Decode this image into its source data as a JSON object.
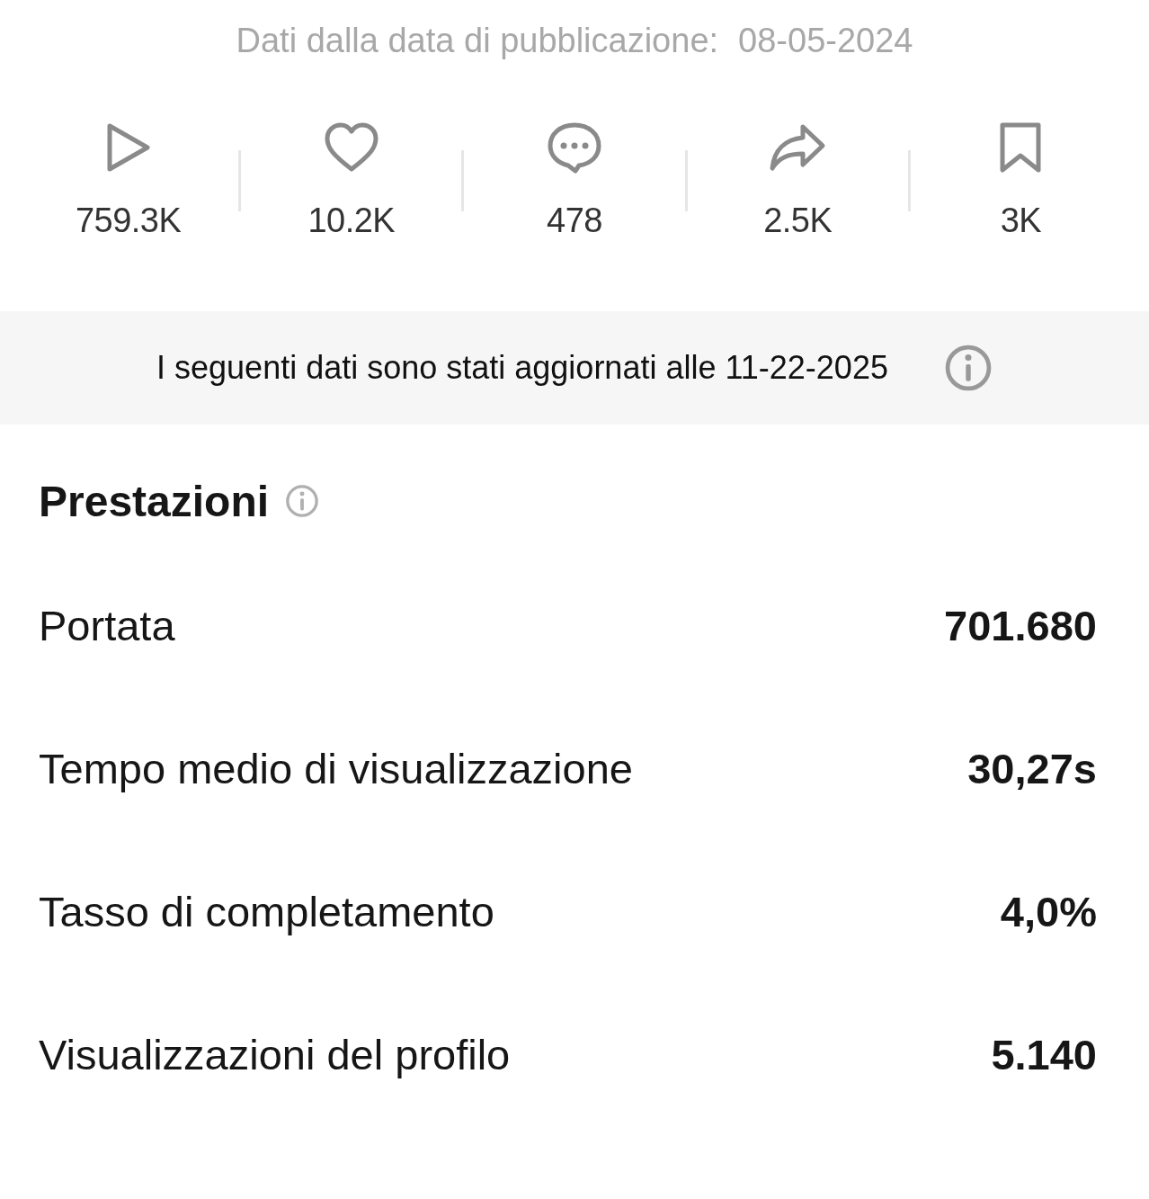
{
  "header": {
    "label": "Dati dalla data di pubblicazione:",
    "date": "08-05-2024"
  },
  "stats": [
    {
      "kind": "play",
      "value": "759.3K"
    },
    {
      "kind": "heart",
      "value": "10.2K"
    },
    {
      "kind": "comment",
      "value": "478"
    },
    {
      "kind": "share",
      "value": "2.5K"
    },
    {
      "kind": "bookmark",
      "value": "3K"
    }
  ],
  "notice": {
    "text": "I seguenti dati sono stati aggiornati alle 11-22-2025"
  },
  "section": {
    "title": "Prestazioni"
  },
  "metrics": [
    {
      "label": "Portata",
      "value": "701.680"
    },
    {
      "label": "Tempo medio di visualizzazione",
      "value": "30,27s"
    },
    {
      "label": "Tasso di completamento",
      "value": "4,0%"
    },
    {
      "label": "Visualizzazioni del profilo",
      "value": "5.140"
    }
  ]
}
